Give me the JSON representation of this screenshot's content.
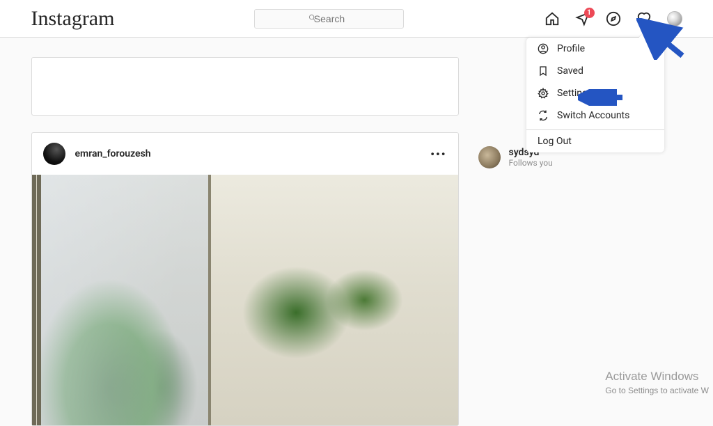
{
  "header": {
    "logo": "Instagram",
    "search_placeholder": "Search",
    "badge_count": "1"
  },
  "dropdown": {
    "profile": "Profile",
    "saved": "Saved",
    "settings": "Settings",
    "switch": "Switch Accounts",
    "logout": "Log Out"
  },
  "post": {
    "username": "emran_forouzesh"
  },
  "suggestion": {
    "name": "sydsyd",
    "sub": "Follows you"
  },
  "watermark": {
    "line1": "Activate Windows",
    "line2": "Go to Settings to activate W"
  },
  "colors": {
    "arrow": "#2455c2"
  }
}
